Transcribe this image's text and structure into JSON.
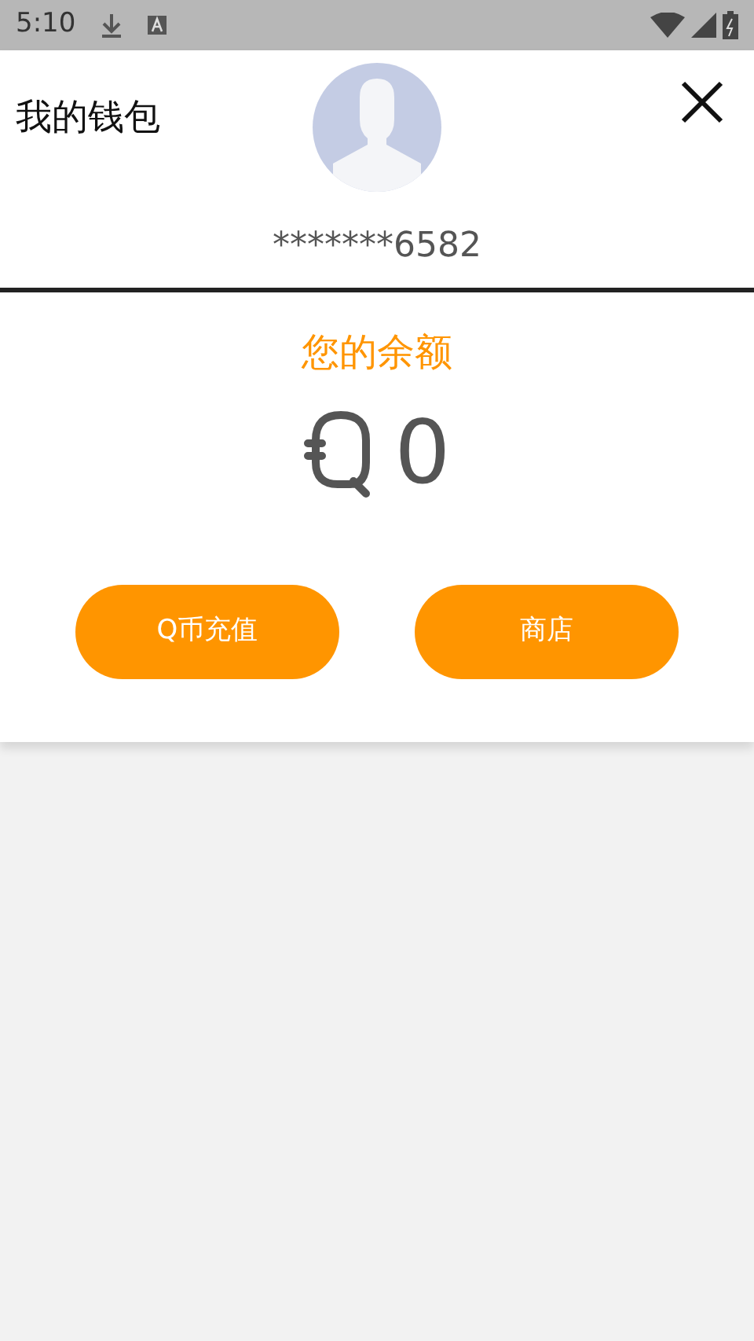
{
  "status_bar": {
    "time": "5:10"
  },
  "header": {
    "title": "我的钱包",
    "account": "*******6582"
  },
  "balance": {
    "label": "您的余额",
    "amount": "0"
  },
  "buttons": [
    {
      "label": "Q币充值"
    },
    {
      "label": "商店"
    }
  ]
}
